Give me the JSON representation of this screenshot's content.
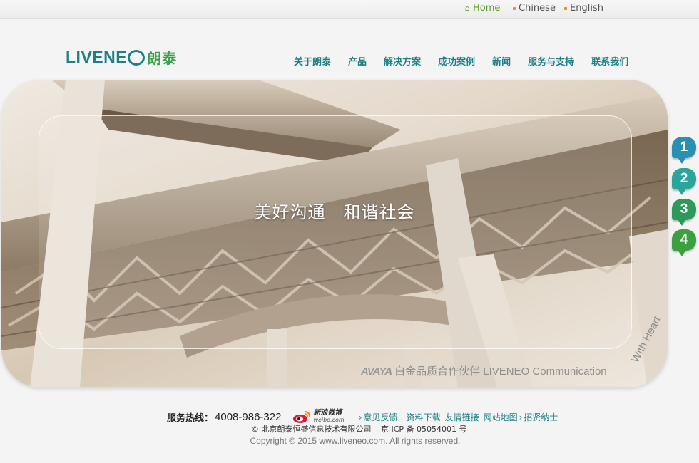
{
  "topbar": {
    "home": "Home",
    "chinese": "Chinese",
    "english": "English"
  },
  "header": {
    "logo_latin": "LIVENE",
    "logo_cn": "朗泰",
    "nav": [
      "关于朗泰",
      "产品",
      "解决方案",
      "成功案例",
      "新闻",
      "服务与支持",
      "联系我们"
    ]
  },
  "banner": {
    "slogan": "美好沟通　和谐社会",
    "partner_brand": "AVAYA",
    "partner_text": "白金品质合作伙伴  LIVENEO Communication",
    "rotated_text": "With Heart",
    "slides": [
      "1",
      "2",
      "3",
      "4"
    ]
  },
  "footer": {
    "hotline_label": "服务热线：",
    "hotline_number": "4008-986-322",
    "weibo_cn": "新浪微博",
    "weibo_en": "weibo.com",
    "links": [
      "意见反馈",
      "资料下载",
      "友情链接",
      "网站地图",
      "招贤纳士"
    ],
    "company": "© 北京朗泰恒盛信息技术有限公司",
    "icp": "京 ICP 备 05054001 号",
    "copyright": "Copyright © 2015 www.liveneo.com. All rights reserved."
  },
  "colors": {
    "nav": "#1c7f86",
    "logo_teal": "#1e7f88",
    "logo_green": "#3aa04a",
    "slide_1": "#2a8fb0",
    "slide_2": "#2aa59a",
    "slide_3": "#2e9a5a",
    "slide_4": "#3da040"
  }
}
